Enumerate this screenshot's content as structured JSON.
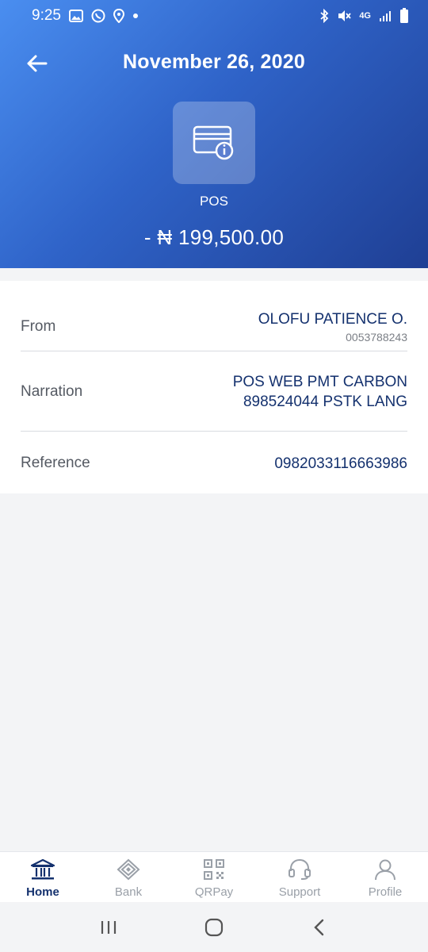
{
  "status_bar": {
    "time": "9:25",
    "left_icons": [
      "gallery-icon",
      "whatsapp-icon",
      "location-icon",
      "dot-icon"
    ],
    "right_icons": [
      "bluetooth-icon",
      "mute-icon",
      "4g-icon",
      "signal-icon",
      "battery-icon"
    ],
    "network": "4G"
  },
  "header": {
    "title": "November 26, 2020",
    "back_icon": "arrow-left-icon",
    "transaction_icon": "card-info-icon",
    "transaction_type": "POS",
    "amount": "- ₦ 199,500.00",
    "gradient_colors": [
      "#4a8ef0",
      "#1f3f94"
    ]
  },
  "details": {
    "from": {
      "label": "From",
      "name": "OLOFU PATIENCE O.",
      "account": "0053788243"
    },
    "narration": {
      "label": "Narration",
      "line1": "POS WEB PMT CARBON",
      "line2": "898524044 PSTK LANG"
    },
    "reference": {
      "label": "Reference",
      "value": "0982033116663986"
    }
  },
  "bottom_nav": {
    "items": [
      {
        "label": "Home",
        "icon": "bank-building-icon",
        "active": true
      },
      {
        "label": "Bank",
        "icon": "diamond-icon",
        "active": false
      },
      {
        "label": "QRPay",
        "icon": "qr-code-icon",
        "active": false
      },
      {
        "label": "Support",
        "icon": "headset-icon",
        "active": false
      },
      {
        "label": "Profile",
        "icon": "user-icon",
        "active": false
      }
    ]
  },
  "system_nav": [
    "recents-icon",
    "home-icon",
    "back-icon"
  ],
  "colors": {
    "accent_dark": "#14316e",
    "label_gray": "#555a63",
    "inactive_gray": "#9aa0a8"
  }
}
